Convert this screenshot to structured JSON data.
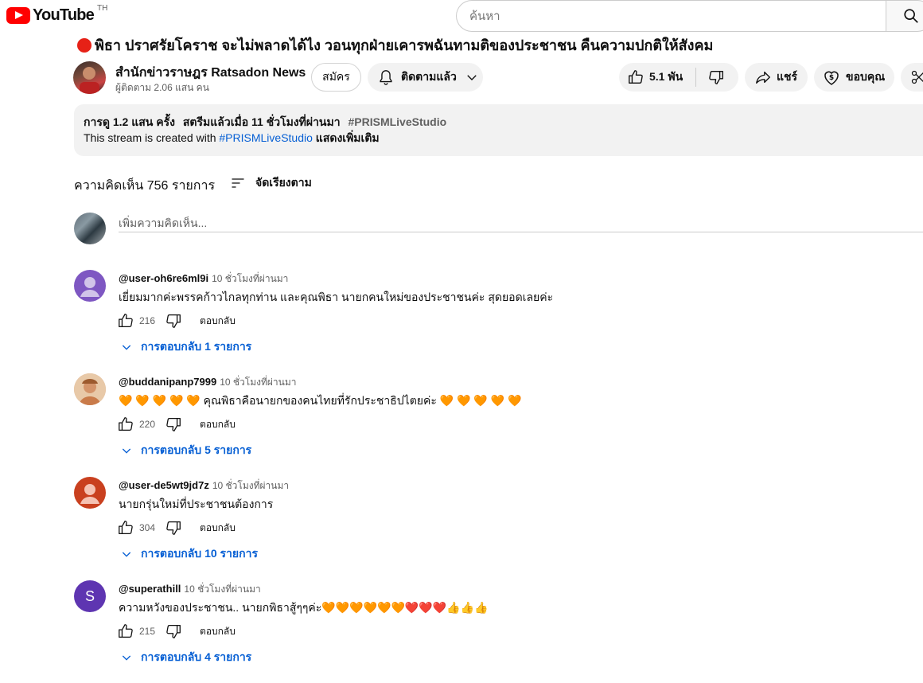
{
  "header": {
    "logo_text": "YouTube",
    "country_code": "TH",
    "search_placeholder": "ค้นหา"
  },
  "video": {
    "title": "พิธา ปราศรัยโคราช จะไม่พลาดได้ไง วอนทุกฝ่ายเคารพฉันทามติของประชาชน คืนความปกติให้สังคม",
    "channel_name": "สำนักข่าวราษฎร Ratsadon News",
    "subscribers": "ผู้ติดตาม 2.06 แสน คน",
    "join_label": "สมัคร",
    "subscribed_label": "ติดตามแล้ว",
    "like_count": "5.1 พัน",
    "share_label": "แชร์",
    "thanks_label": "ขอบคุณ"
  },
  "description": {
    "views": "การดู 1.2 แสน ครั้ง",
    "streamed": "สตรีมแล้วเมื่อ 11 ชั่วโมงที่ผ่านมา",
    "hashtag": "#PRISMLiveStudio",
    "body_prefix": "This stream is created with ",
    "body_link": "#PRISMLiveStudio",
    "show_more": " แสดงเพิ่มเติม"
  },
  "comments_header": {
    "count_label": "ความคิดเห็น 756 รายการ",
    "sort_label": "จัดเรียงตาม",
    "add_placeholder": "เพิ่มความคิดเห็น..."
  },
  "comments": [
    {
      "author": "@user-oh6re6ml9i",
      "time": "10 ชั่วโมงที่ผ่านมา",
      "text": "เยี่ยมมากค่ะพรรคก้าวไกลทุกท่าน และคุณพิธา นายกคนใหม่ของประชาชนค่ะ สุดยอดเลยค่ะ",
      "likes": "216",
      "reply_label": "ตอบกลับ",
      "replies_label": "การตอบกลับ 1 รายการ",
      "avatar_color": "#7e57c2",
      "avatar_letter": ""
    },
    {
      "author": "@buddanipanp7999",
      "time": "10 ชั่วโมงที่ผ่านมา",
      "text": "🧡 🧡 🧡 🧡 🧡 คุณพิธาคือนายกของคนไทยที่รักประชาธิปไตยค่ะ 🧡 🧡 🧡 🧡 🧡",
      "likes": "220",
      "reply_label": "ตอบกลับ",
      "replies_label": "การตอบกลับ 5 รายการ",
      "avatar_color": "#d9a27a",
      "avatar_letter": ""
    },
    {
      "author": "@user-de5wt9jd7z",
      "time": "10 ชั่วโมงที่ผ่านมา",
      "text": "นายกรุ่นใหม่ที่ประชาชนต้องการ",
      "likes": "304",
      "reply_label": "ตอบกลับ",
      "replies_label": "การตอบกลับ 10 รายการ",
      "avatar_color": "#c9401f",
      "avatar_letter": ""
    },
    {
      "author": "@superathill",
      "time": "10 ชั่วโมงที่ผ่านมา",
      "text": "ความหวังของประชาชน.. นายกพิธาสู้ๆๆค่ะ🧡🧡🧡🧡🧡🧡❤️❤️❤️👍👍👍",
      "likes": "215",
      "reply_label": "ตอบกลับ",
      "replies_label": "การตอบกลับ 4 รายการ",
      "avatar_color": "#5e35b1",
      "avatar_letter": "S"
    }
  ]
}
